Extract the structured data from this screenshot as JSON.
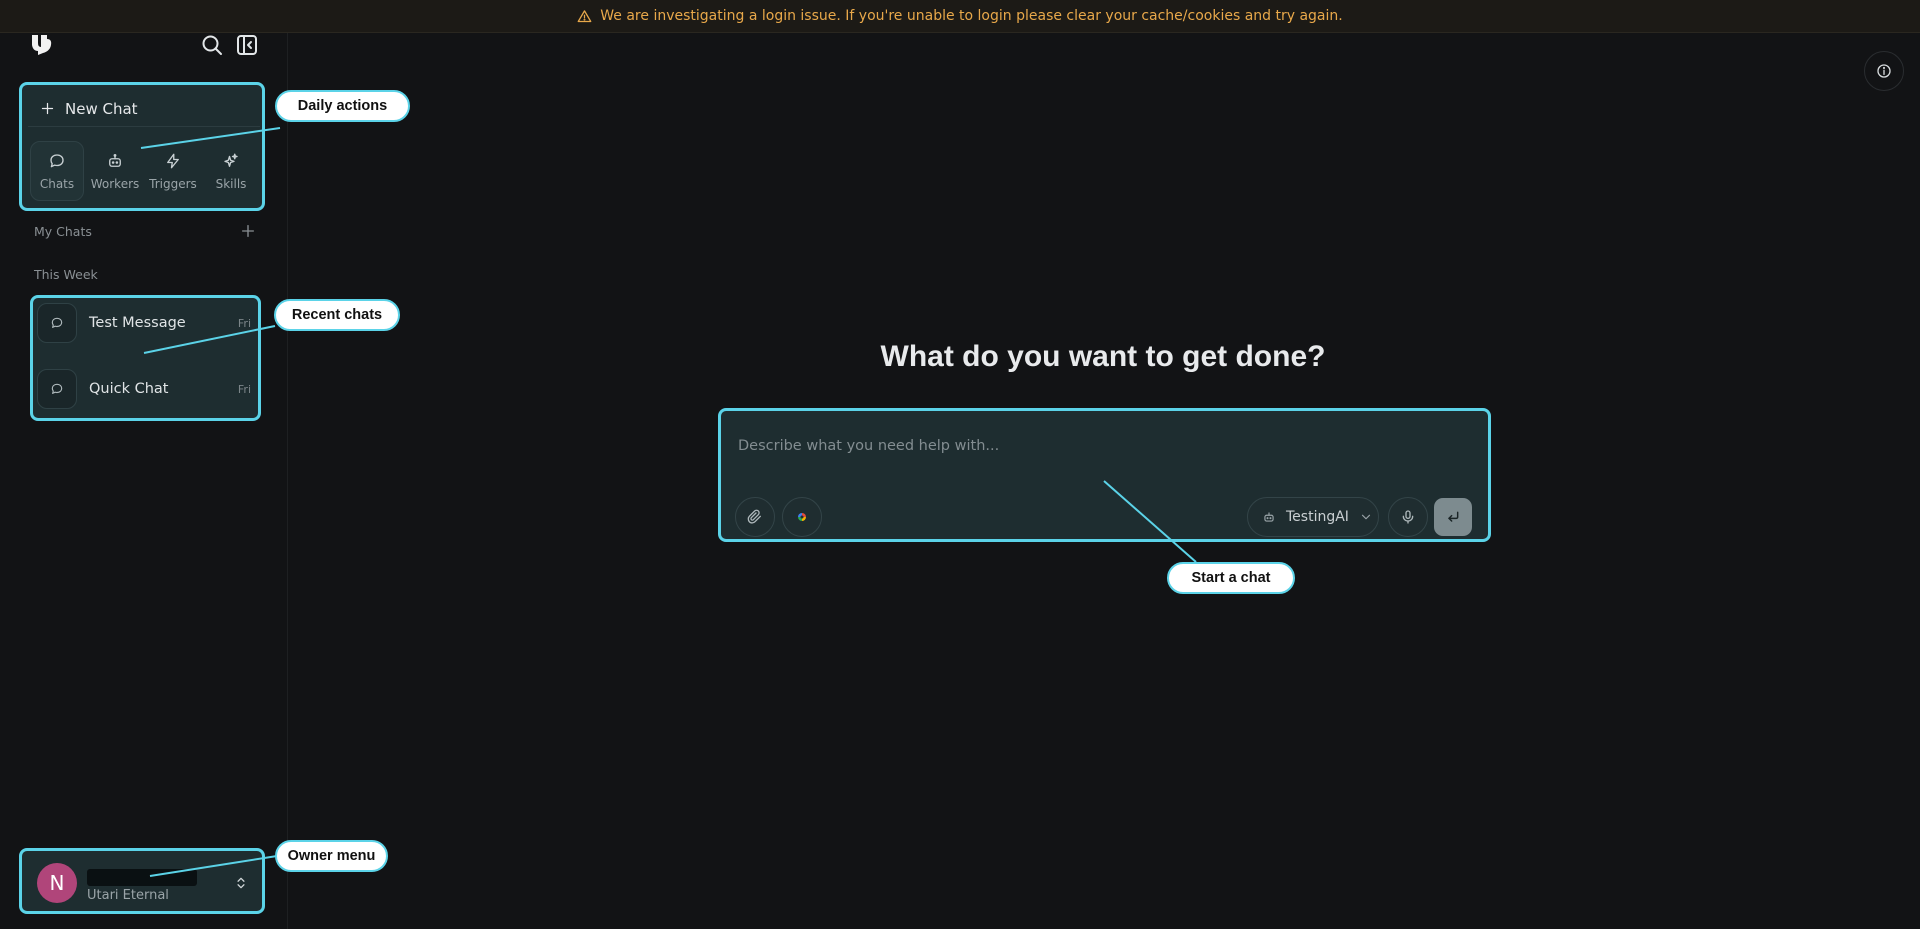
{
  "banner": {
    "icon": "warning-icon",
    "text": "We are investigating a login issue. If you're unable to login please clear your cache/cookies and try again.",
    "color": "#e8a84a"
  },
  "sidebar": {
    "new_chat_label": "New Chat",
    "actions": [
      {
        "label": "Chats",
        "icon": "chat-bubble-icon",
        "active": true
      },
      {
        "label": "Workers",
        "icon": "robot-icon",
        "active": false
      },
      {
        "label": "Triggers",
        "icon": "lightning-icon",
        "active": false
      },
      {
        "label": "Skills",
        "icon": "sparkles-icon",
        "active": false
      }
    ],
    "my_chats_label": "My Chats",
    "this_week_label": "This Week",
    "chats": [
      {
        "title": "Test Message",
        "date": "Fri"
      },
      {
        "title": "Quick Chat",
        "date": "Fri"
      }
    ],
    "owner": {
      "initial": "N",
      "org": "Utari Eternal",
      "avatar_color": "#b0457a"
    }
  },
  "callouts": {
    "daily_actions": "Daily actions",
    "recent_chats": "Recent chats",
    "start_chat": "Start a chat",
    "owner_menu": "Owner menu"
  },
  "main": {
    "headline": "What do you want to get done?",
    "composer": {
      "placeholder": "Describe what you need help with...",
      "value": "",
      "model": "TestingAI"
    }
  },
  "colors": {
    "accent": "#5bd3e8",
    "background": "#121315"
  }
}
